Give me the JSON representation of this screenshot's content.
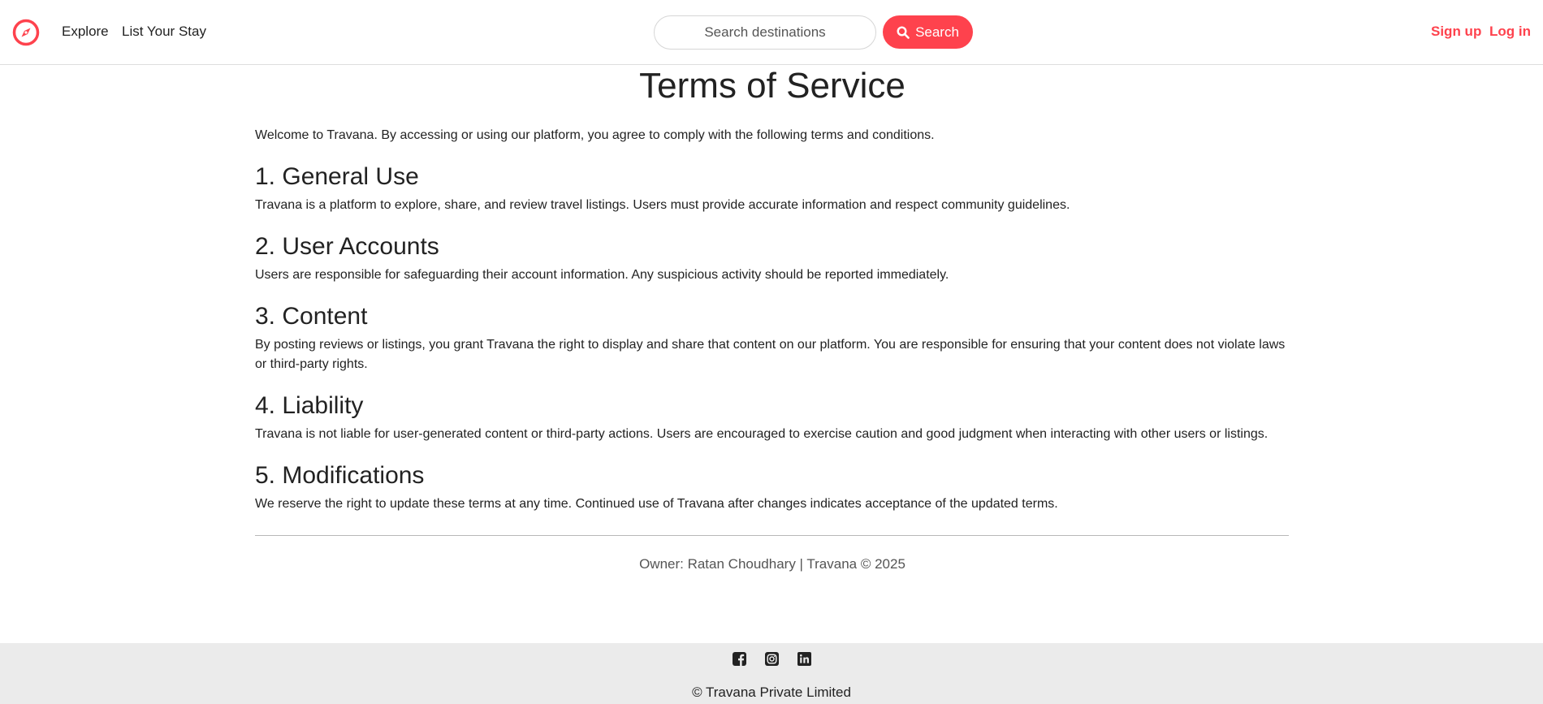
{
  "navbar": {
    "logo_icon": "compass-icon",
    "explore_label": "Explore",
    "list_stay_label": "List Your Stay",
    "search_placeholder": "Search destinations",
    "search_button_label": "Search",
    "search_icon": "search-icon",
    "signup_label": "Sign up",
    "login_label": "Log in",
    "accent_color": "#fe424d"
  },
  "main": {
    "title": "Terms of Service",
    "intro": "Welcome to Travana. By accessing or using our platform, you agree to comply with the following terms and conditions.",
    "sections": [
      {
        "heading": "1. General Use",
        "body": "Travana is a platform to explore, share, and review travel listings. Users must provide accurate information and respect community guidelines."
      },
      {
        "heading": "2. User Accounts",
        "body": "Users are responsible for safeguarding their account information. Any suspicious activity should be reported immediately."
      },
      {
        "heading": "3. Content",
        "body": "By posting reviews or listings, you grant Travana the right to display and share that content on our platform. You are responsible for ensuring that your content does not violate laws or third-party rights."
      },
      {
        "heading": "4. Liability",
        "body": "Travana is not liable for user-generated content or third-party actions. Users are encouraged to exercise caution and good judgment when interacting with other users or listings."
      },
      {
        "heading": "5. Modifications",
        "body": "We reserve the right to update these terms at any time. Continued use of Travana after changes indicates acceptance of the updated terms."
      }
    ],
    "owner_line": "Owner: Ratan Choudhary | Travana © 2025"
  },
  "footer": {
    "social_icons": [
      "facebook-icon",
      "instagram-icon",
      "linkedin-icon"
    ],
    "copyright": "© Travana Private Limited",
    "background_color": "#ebebeb"
  }
}
